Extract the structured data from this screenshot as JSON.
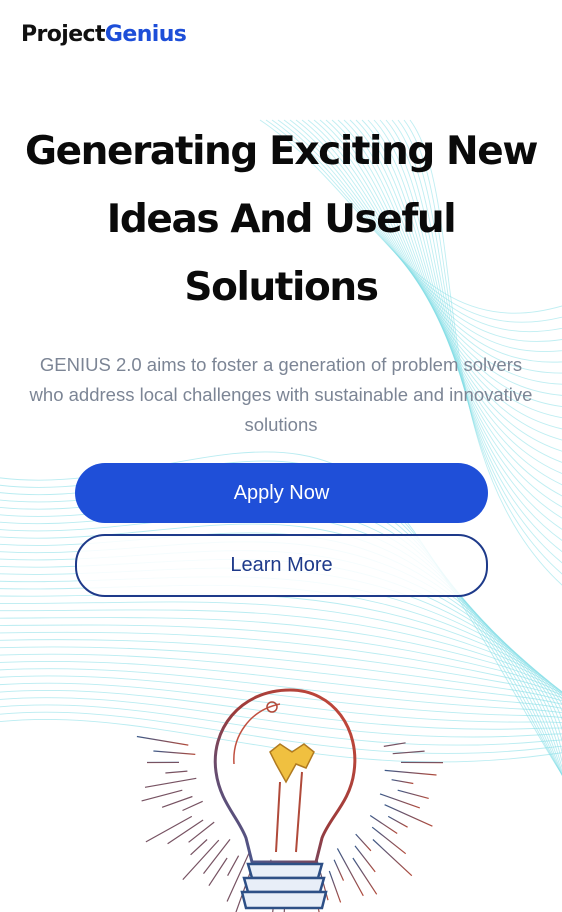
{
  "brand": {
    "part1": "Project",
    "part2": "Genius"
  },
  "hero": {
    "title": "Generating Exciting New Ideas And Useful Solutions",
    "subtitle": "GENIUS 2.0 aims to foster a generation of problem solvers who address local challenges with sustainable and innovative solutions"
  },
  "actions": {
    "apply_label": "Apply Now",
    "learn_label": "Learn More"
  },
  "colors": {
    "brand_accent": "#1f4fd8",
    "outline": "#1e3a8a",
    "waves": "#7fdde6"
  },
  "illustration": {
    "icon": "light-bulb-icon"
  }
}
